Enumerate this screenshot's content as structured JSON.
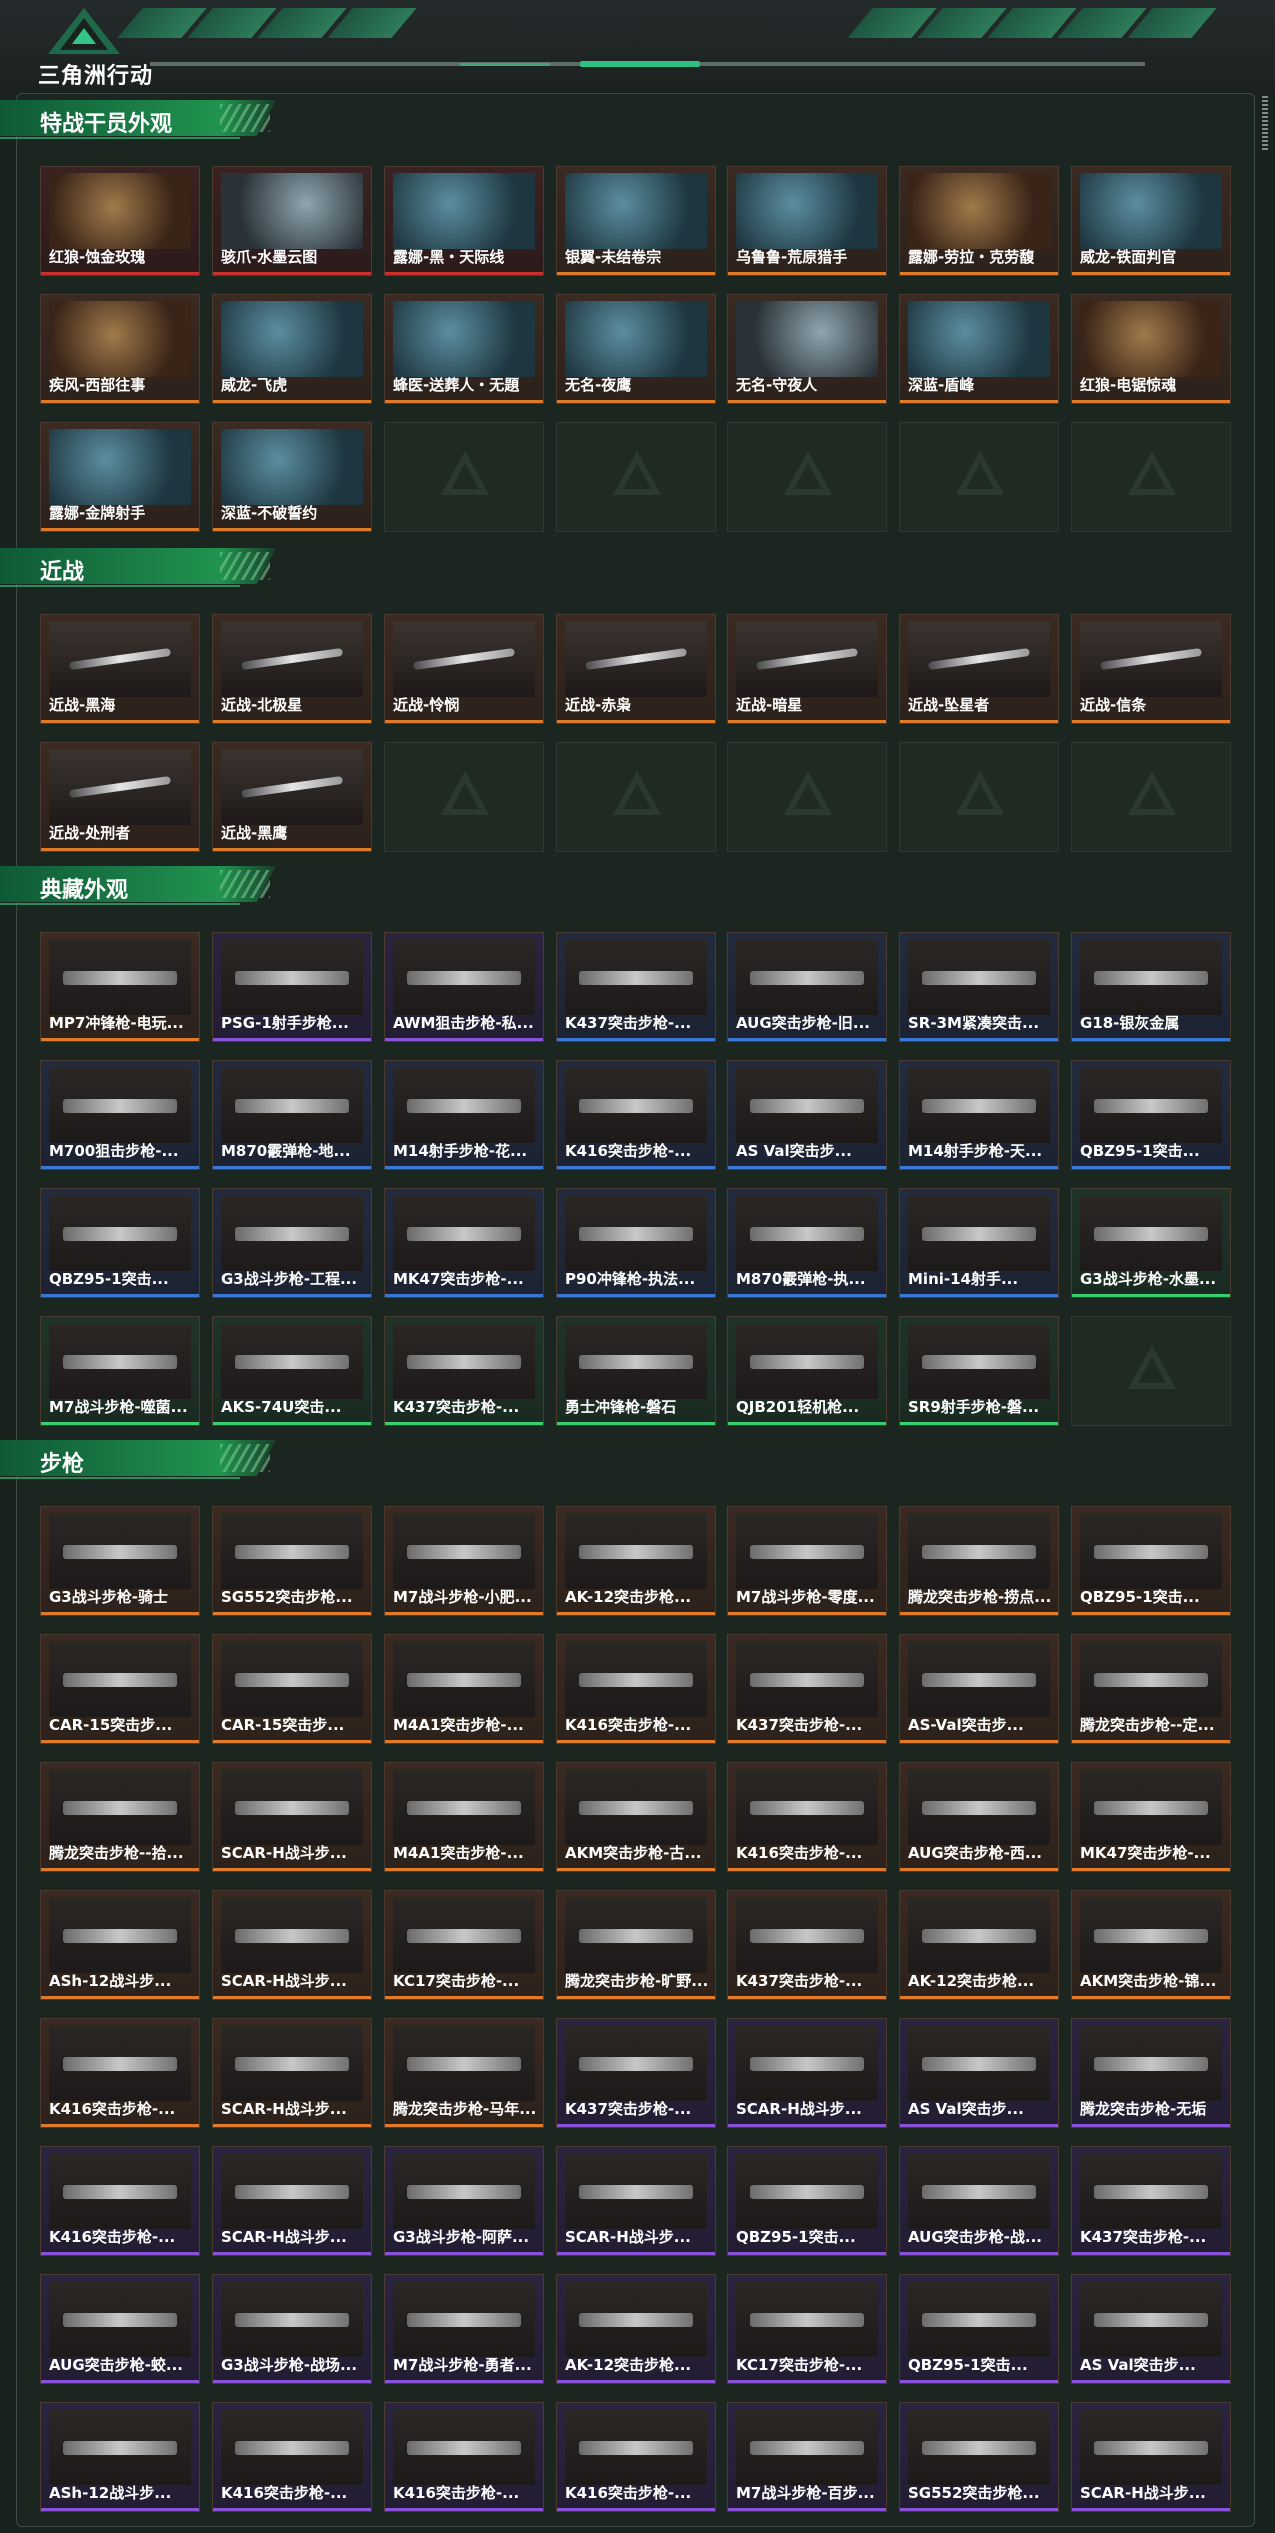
{
  "app": {
    "title": "三角洲行动"
  },
  "sections": [
    {
      "title": "特战干员外观",
      "items": [
        {
          "label": "红狼-蚀金玫瑰",
          "rarity": "red",
          "kind": "skin3"
        },
        {
          "label": "骇爪-水墨云图",
          "rarity": "red",
          "kind": "skin2"
        },
        {
          "label": "露娜-黑・天际线",
          "rarity": "red",
          "kind": "skin"
        },
        {
          "label": "银翼-未结卷宗",
          "rarity": "orange",
          "kind": "skin"
        },
        {
          "label": "乌鲁鲁-荒原猎手",
          "rarity": "orange",
          "kind": "skin"
        },
        {
          "label": "露娜-劳拉・克劳馥",
          "rarity": "orange",
          "kind": "skin3"
        },
        {
          "label": "威龙-铁面判官",
          "rarity": "orange",
          "kind": "skin"
        },
        {
          "label": "疾风-西部往事",
          "rarity": "orange",
          "kind": "skin3"
        },
        {
          "label": "威龙-飞虎",
          "rarity": "orange",
          "kind": "skin"
        },
        {
          "label": "蜂医-送葬人・无題",
          "rarity": "orange",
          "kind": "skin"
        },
        {
          "label": "无名-夜鹰",
          "rarity": "orange",
          "kind": "skin"
        },
        {
          "label": "无名-守夜人",
          "rarity": "orange",
          "kind": "skin2"
        },
        {
          "label": "深蓝-盾峰",
          "rarity": "orange",
          "kind": "skin"
        },
        {
          "label": "红狼-电锯惊魂",
          "rarity": "orange",
          "kind": "skin3"
        },
        {
          "label": "露娜-金牌射手",
          "rarity": "orange",
          "kind": "skin"
        },
        {
          "label": "深蓝-不破誓约",
          "rarity": "orange",
          "kind": "skin"
        }
      ],
      "empty_slots": 5
    },
    {
      "title": "近战",
      "items": [
        {
          "label": "近战-黑海",
          "rarity": "orange",
          "kind": "knife"
        },
        {
          "label": "近战-北极星",
          "rarity": "orange",
          "kind": "knife"
        },
        {
          "label": "近战-怜悯",
          "rarity": "orange",
          "kind": "knife"
        },
        {
          "label": "近战-赤枭",
          "rarity": "orange",
          "kind": "knife"
        },
        {
          "label": "近战-暗星",
          "rarity": "orange",
          "kind": "knife"
        },
        {
          "label": "近战-坠星者",
          "rarity": "orange",
          "kind": "knife"
        },
        {
          "label": "近战-信条",
          "rarity": "orange",
          "kind": "knife"
        },
        {
          "label": "近战-处刑者",
          "rarity": "orange",
          "kind": "knife"
        },
        {
          "label": "近战-黑鹰",
          "rarity": "orange",
          "kind": "knife"
        }
      ],
      "empty_slots": 5
    },
    {
      "title": "典藏外观",
      "items": [
        {
          "label": "MP7冲锋枪-电玩...",
          "rarity": "orange",
          "kind": "gun"
        },
        {
          "label": "PSG-1射手步枪...",
          "rarity": "purple",
          "kind": "gun"
        },
        {
          "label": "AWM狙击步枪-私...",
          "rarity": "purple",
          "kind": "gun"
        },
        {
          "label": "K437突击步枪-...",
          "rarity": "blue",
          "kind": "gun"
        },
        {
          "label": "AUG突击步枪-旧...",
          "rarity": "blue",
          "kind": "gun"
        },
        {
          "label": "SR-3M紧凑突击...",
          "rarity": "blue",
          "kind": "gun"
        },
        {
          "label": "G18-银灰金属",
          "rarity": "blue",
          "kind": "gun"
        },
        {
          "label": "M700狙击步枪-...",
          "rarity": "blue",
          "kind": "gun"
        },
        {
          "label": "M870霰弹枪-地...",
          "rarity": "blue",
          "kind": "gun"
        },
        {
          "label": "M14射手步枪-花...",
          "rarity": "blue",
          "kind": "gun"
        },
        {
          "label": "K416突击步枪-...",
          "rarity": "blue",
          "kind": "gun"
        },
        {
          "label": "AS Val突击步...",
          "rarity": "blue",
          "kind": "gun"
        },
        {
          "label": "M14射手步枪-天...",
          "rarity": "blue",
          "kind": "gun"
        },
        {
          "label": "QBZ95-1突击...",
          "rarity": "blue",
          "kind": "gun"
        },
        {
          "label": "QBZ95-1突击...",
          "rarity": "blue",
          "kind": "gun"
        },
        {
          "label": "G3战斗步枪-工程...",
          "rarity": "blue",
          "kind": "gun"
        },
        {
          "label": "MK47突击步枪-...",
          "rarity": "blue",
          "kind": "gun"
        },
        {
          "label": "P90冲锋枪-执法...",
          "rarity": "blue",
          "kind": "gun"
        },
        {
          "label": "M870霰弹枪-执...",
          "rarity": "blue",
          "kind": "gun"
        },
        {
          "label": "Mini-14射手...",
          "rarity": "blue",
          "kind": "gun"
        },
        {
          "label": "G3战斗步枪-水墨...",
          "rarity": "green",
          "kind": "gun"
        },
        {
          "label": "M7战斗步枪-噬菌...",
          "rarity": "green",
          "kind": "gun"
        },
        {
          "label": "AKS-74U突击...",
          "rarity": "green",
          "kind": "gun"
        },
        {
          "label": "K437突击步枪-...",
          "rarity": "green",
          "kind": "gun"
        },
        {
          "label": "勇士冲锋枪-磐石",
          "rarity": "green",
          "kind": "gun"
        },
        {
          "label": "QJB201轻机枪...",
          "rarity": "green",
          "kind": "gun"
        },
        {
          "label": "SR9射手步枪-磐...",
          "rarity": "green",
          "kind": "gun"
        }
      ],
      "empty_slots": 1
    },
    {
      "title": "步枪",
      "items": [
        {
          "label": "G3战斗步枪-骑士",
          "rarity": "orange",
          "kind": "gun"
        },
        {
          "label": "SG552突击步枪...",
          "rarity": "orange",
          "kind": "gun"
        },
        {
          "label": "M7战斗步枪-小肥...",
          "rarity": "orange",
          "kind": "gun"
        },
        {
          "label": "AK-12突击步枪...",
          "rarity": "orange",
          "kind": "gun"
        },
        {
          "label": "M7战斗步枪-零度...",
          "rarity": "orange",
          "kind": "gun"
        },
        {
          "label": "腾龙突击步枪-捞点...",
          "rarity": "orange",
          "kind": "gun"
        },
        {
          "label": "QBZ95-1突击...",
          "rarity": "orange",
          "kind": "gun"
        },
        {
          "label": "CAR-15突击步...",
          "rarity": "orange",
          "kind": "gun"
        },
        {
          "label": "CAR-15突击步...",
          "rarity": "orange",
          "kind": "gun"
        },
        {
          "label": "M4A1突击步枪-...",
          "rarity": "orange",
          "kind": "gun"
        },
        {
          "label": "K416突击步枪-...",
          "rarity": "orange",
          "kind": "gun"
        },
        {
          "label": "K437突击步枪-...",
          "rarity": "orange",
          "kind": "gun"
        },
        {
          "label": "AS-Val突击步...",
          "rarity": "orange",
          "kind": "gun"
        },
        {
          "label": "腾龙突击步枪--定...",
          "rarity": "orange",
          "kind": "gun"
        },
        {
          "label": "腾龙突击步枪--拾...",
          "rarity": "orange",
          "kind": "gun"
        },
        {
          "label": "SCAR-H战斗步...",
          "rarity": "orange",
          "kind": "gun"
        },
        {
          "label": "M4A1突击步枪-...",
          "rarity": "orange",
          "kind": "gun"
        },
        {
          "label": "AKM突击步枪-古...",
          "rarity": "orange",
          "kind": "gun"
        },
        {
          "label": "K416突击步枪-...",
          "rarity": "orange",
          "kind": "gun"
        },
        {
          "label": "AUG突击步枪-西...",
          "rarity": "orange",
          "kind": "gun"
        },
        {
          "label": "MK47突击步枪-...",
          "rarity": "orange",
          "kind": "gun"
        },
        {
          "label": "ASh-12战斗步...",
          "rarity": "orange",
          "kind": "gun"
        },
        {
          "label": "SCAR-H战斗步...",
          "rarity": "orange",
          "kind": "gun"
        },
        {
          "label": "KC17突击步枪-...",
          "rarity": "orange",
          "kind": "gun"
        },
        {
          "label": "腾龙突击步枪-旷野...",
          "rarity": "orange",
          "kind": "gun"
        },
        {
          "label": "K437突击步枪-...",
          "rarity": "orange",
          "kind": "gun"
        },
        {
          "label": "AK-12突击步枪...",
          "rarity": "orange",
          "kind": "gun"
        },
        {
          "label": "AKM突击步枪-锦...",
          "rarity": "orange",
          "kind": "gun"
        },
        {
          "label": "K416突击步枪-...",
          "rarity": "orange",
          "kind": "gun"
        },
        {
          "label": "SCAR-H战斗步...",
          "rarity": "orange",
          "kind": "gun"
        },
        {
          "label": "腾龙突击步枪-马年...",
          "rarity": "orange",
          "kind": "gun"
        },
        {
          "label": "K437突击步枪-...",
          "rarity": "purple",
          "kind": "gun"
        },
        {
          "label": "SCAR-H战斗步...",
          "rarity": "purple",
          "kind": "gun"
        },
        {
          "label": "AS Val突击步...",
          "rarity": "purple",
          "kind": "gun"
        },
        {
          "label": "腾龙突击步枪-无垢",
          "rarity": "purple",
          "kind": "gun"
        },
        {
          "label": "K416突击步枪-...",
          "rarity": "purple",
          "kind": "gun"
        },
        {
          "label": "SCAR-H战斗步...",
          "rarity": "purple",
          "kind": "gun"
        },
        {
          "label": "G3战斗步枪-阿萨...",
          "rarity": "purple",
          "kind": "gun"
        },
        {
          "label": "SCAR-H战斗步...",
          "rarity": "purple",
          "kind": "gun"
        },
        {
          "label": "QBZ95-1突击...",
          "rarity": "purple",
          "kind": "gun"
        },
        {
          "label": "AUG突击步枪-战...",
          "rarity": "purple",
          "kind": "gun"
        },
        {
          "label": "K437突击步枪-...",
          "rarity": "purple",
          "kind": "gun"
        },
        {
          "label": "AUG突击步枪-蛟...",
          "rarity": "purple",
          "kind": "gun"
        },
        {
          "label": "G3战斗步枪-战场...",
          "rarity": "purple",
          "kind": "gun"
        },
        {
          "label": "M7战斗步枪-勇者...",
          "rarity": "purple",
          "kind": "gun"
        },
        {
          "label": "AK-12突击步枪...",
          "rarity": "purple",
          "kind": "gun"
        },
        {
          "label": "KC17突击步枪-...",
          "rarity": "purple",
          "kind": "gun"
        },
        {
          "label": "QBZ95-1突击...",
          "rarity": "purple",
          "kind": "gun"
        },
        {
          "label": "AS Val突击步...",
          "rarity": "purple",
          "kind": "gun"
        },
        {
          "label": "ASh-12战斗步...",
          "rarity": "purple",
          "kind": "gun"
        },
        {
          "label": "K416突击步枪-...",
          "rarity": "purple",
          "kind": "gun"
        },
        {
          "label": "K416突击步枪-...",
          "rarity": "purple",
          "kind": "gun"
        },
        {
          "label": "K416突击步枪-...",
          "rarity": "purple",
          "kind": "gun"
        },
        {
          "label": "M7战斗步枪-百步...",
          "rarity": "purple",
          "kind": "gun"
        },
        {
          "label": "SG552突击步枪...",
          "rarity": "purple",
          "kind": "gun"
        },
        {
          "label": "SCAR-H战斗步...",
          "rarity": "purple",
          "kind": "gun"
        }
      ],
      "empty_slots": 0
    }
  ]
}
